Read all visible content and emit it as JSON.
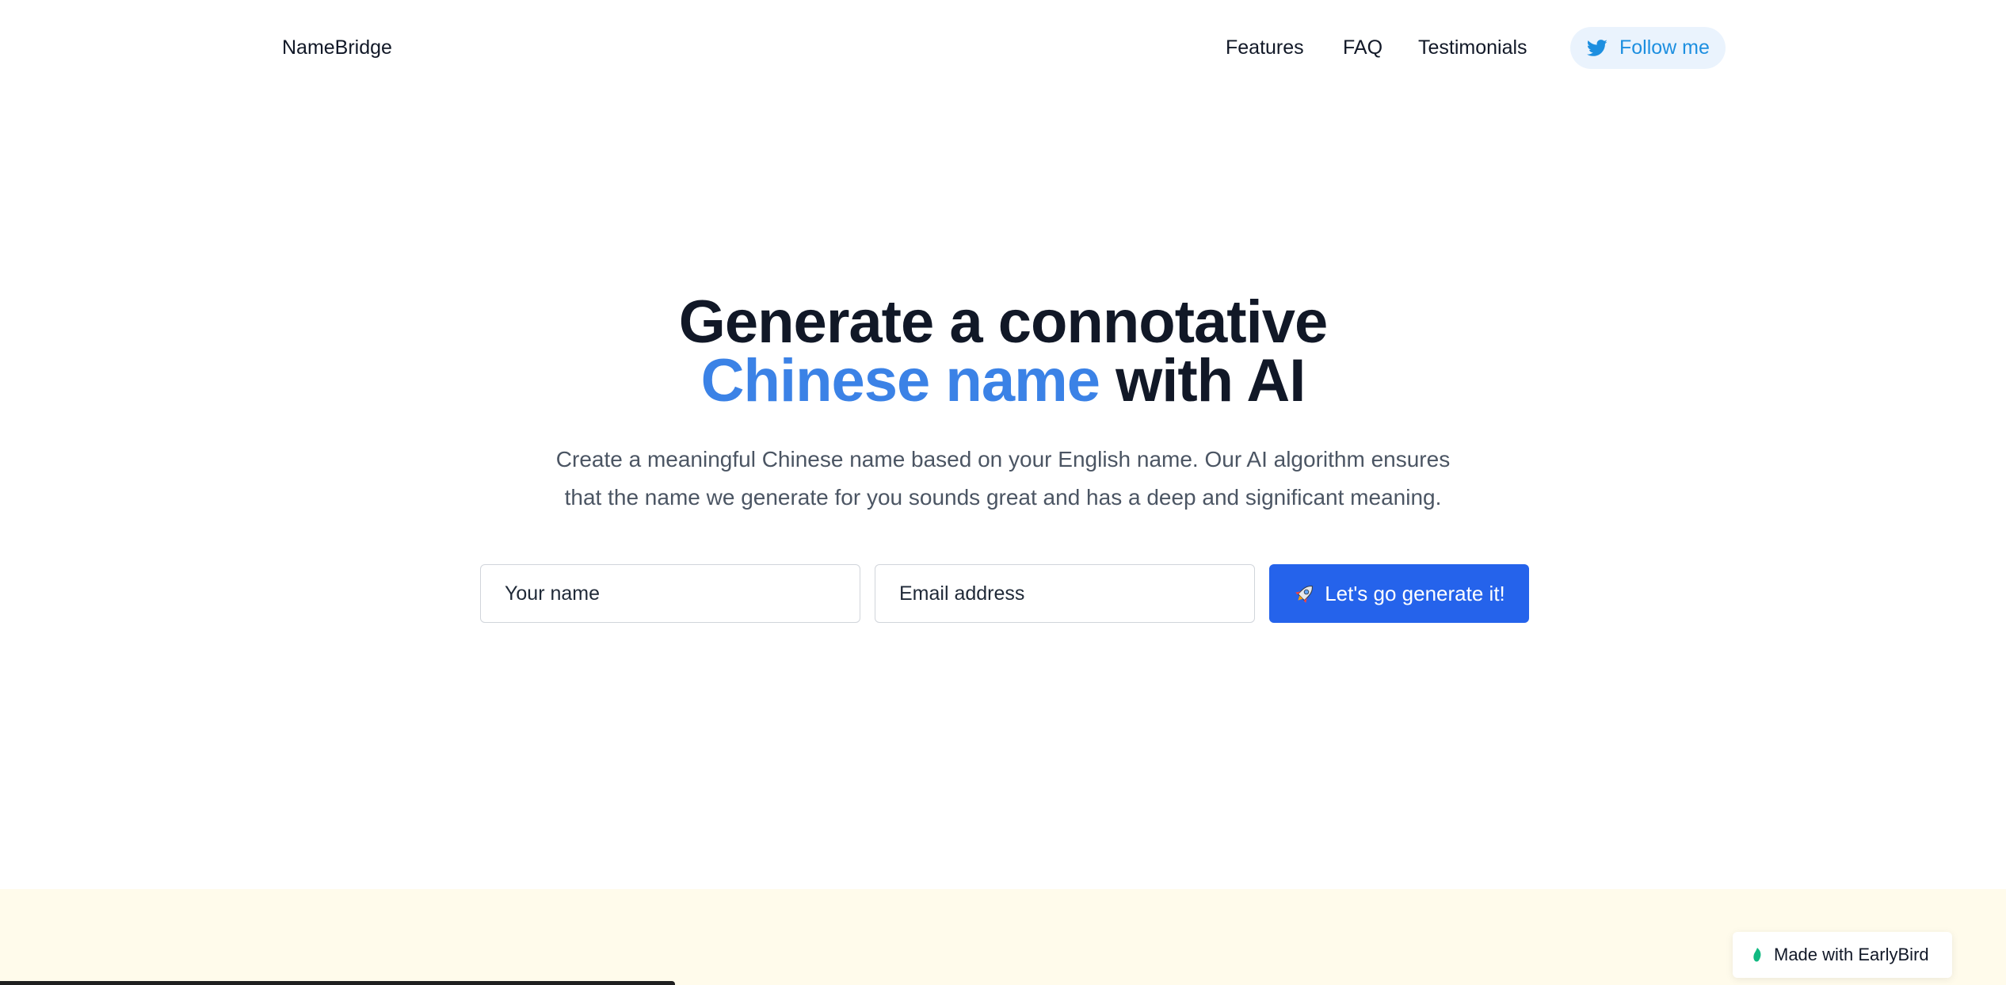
{
  "header": {
    "brand": "NameBridge",
    "nav": [
      {
        "label": "Features"
      },
      {
        "label": "FAQ"
      },
      {
        "label": "Testimonials"
      }
    ],
    "follow_label": "Follow me",
    "follow_icon": "twitter-icon"
  },
  "hero": {
    "title_line1": "Generate a connotative",
    "title_accent": "Chinese name",
    "title_rest": " with AI",
    "subtitle_line1": "Create a meaningful Chinese name based on your English name. Our AI algorithm ensures",
    "subtitle_line2": "that the name we generate for you sounds great and has a deep and significant meaning."
  },
  "form": {
    "name_placeholder": "Your name",
    "email_placeholder": "Email address",
    "submit_label": "Let's go generate it!",
    "submit_icon": "rocket-icon"
  },
  "badge": {
    "label": "Made with EarlyBird",
    "icon": "leaf-icon"
  },
  "colors": {
    "accent": "#3b82e6",
    "button": "#2563eb",
    "twitter": "#1d8fe0",
    "cream": "#fffbeb"
  }
}
